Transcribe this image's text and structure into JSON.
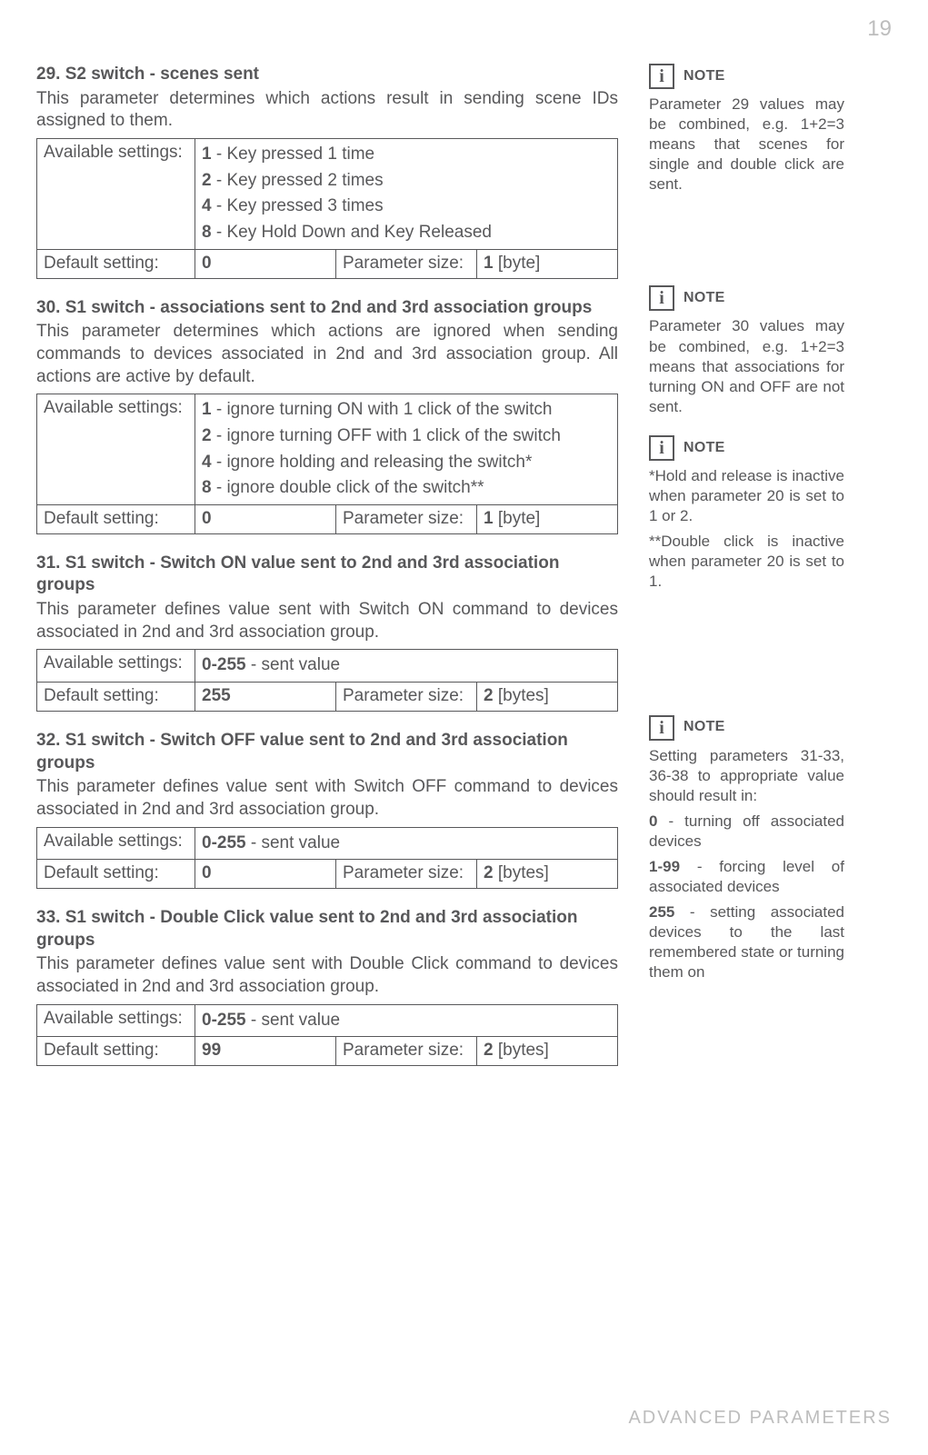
{
  "page_number": "19",
  "footer": "ADVANCED PARAMETERS",
  "labels": {
    "available": "Available settings:",
    "default": "Default setting:",
    "psize": "Parameter size:"
  },
  "sections": [
    {
      "id": "p29",
      "title": "29. S2 switch - scenes sent",
      "desc": "This parameter determines which actions result in sending scene IDs assigned to them.",
      "options": [
        {
          "b": "1",
          "t": " - Key pressed 1 time"
        },
        {
          "b": "2",
          "t": " - Key pressed 2 times"
        },
        {
          "b": "4",
          "t": " - Key pressed 3 times"
        },
        {
          "b": "8",
          "t": " - Key Hold Down and Key Released"
        }
      ],
      "default": "0",
      "psize_b": "1",
      "psize_t": " [byte]"
    },
    {
      "id": "p30",
      "title": "30. S1 switch - associations sent to 2nd and 3rd association groups",
      "desc": "This parameter determines which actions are ignored when sending commands to devices associated in 2nd and 3rd association group. All actions are active by default.",
      "options": [
        {
          "b": "1",
          "t": " - ignore turning ON with 1 click of the switch"
        },
        {
          "b": "2",
          "t": " - ignore turning OFF with 1 click of the switch"
        },
        {
          "b": "4",
          "t": " - ignore holding and releasing the switch*"
        },
        {
          "b": "8",
          "t": " - ignore double click of the switch**"
        }
      ],
      "default": "0",
      "psize_b": "1",
      "psize_t": " [byte]"
    },
    {
      "id": "p31",
      "title": "31. S1 switch - Switch ON value sent to 2nd and 3rd association groups",
      "desc": "This parameter defines value sent with Switch ON command to devic­es associated in 2nd and 3rd association group.",
      "options": [
        {
          "b": "0-255",
          "t": " - sent value"
        }
      ],
      "default": "255",
      "psize_b": "2",
      "psize_t": " [bytes]"
    },
    {
      "id": "p32",
      "title": "32. S1 switch - Switch OFF value sent to 2nd and 3rd association groups",
      "desc": "This parameter defines value sent with Switch OFF command to de­vices associated in 2nd and 3rd association group.",
      "options": [
        {
          "b": "0-255",
          "t": " - sent value"
        }
      ],
      "default": "0",
      "psize_b": "2",
      "psize_t": " [bytes]"
    },
    {
      "id": "p33",
      "title": "33. S1 switch - Double Click value sent to 2nd and 3rd association groups",
      "desc": "This parameter defines value sent with Double Click command to de­vices associated in 2nd and 3rd association group.",
      "options": [
        {
          "b": "0-255",
          "t": " - sent value"
        }
      ],
      "default": "99",
      "psize_b": "2",
      "psize_t": " [bytes]"
    }
  ],
  "notes": {
    "n1": {
      "label": "NOTE",
      "body": "Parameter 29 values may be combined, e.g. 1+2=3 means that scenes for single and double click are sent."
    },
    "n2": {
      "label": "NOTE",
      "body": "Parameter 30 values may be combined, e.g. 1+2=3 means that as­sociations for turning ON and OFF are  not sent."
    },
    "n3": {
      "label": "NOTE",
      "body1": "*Hold and release is inactive when param­eter 20 is set to 1 or 2.",
      "body2": "**Double click is inac­tive when parameter 20 is set to 1."
    },
    "n4": {
      "label": "NOTE",
      "p1": "Setting parameters 31-33, 36-38 to appro­priate value should re­sult in:",
      "p2_b": "0",
      "p2_t": " - turning off associ­ated devices",
      "p3_b": "1-99",
      "p3_t": " - forcing level of associated devices",
      "p4_b": "255",
      "p4_t": " - setting associat­ed devices to the last remembered state or turning them on"
    }
  }
}
